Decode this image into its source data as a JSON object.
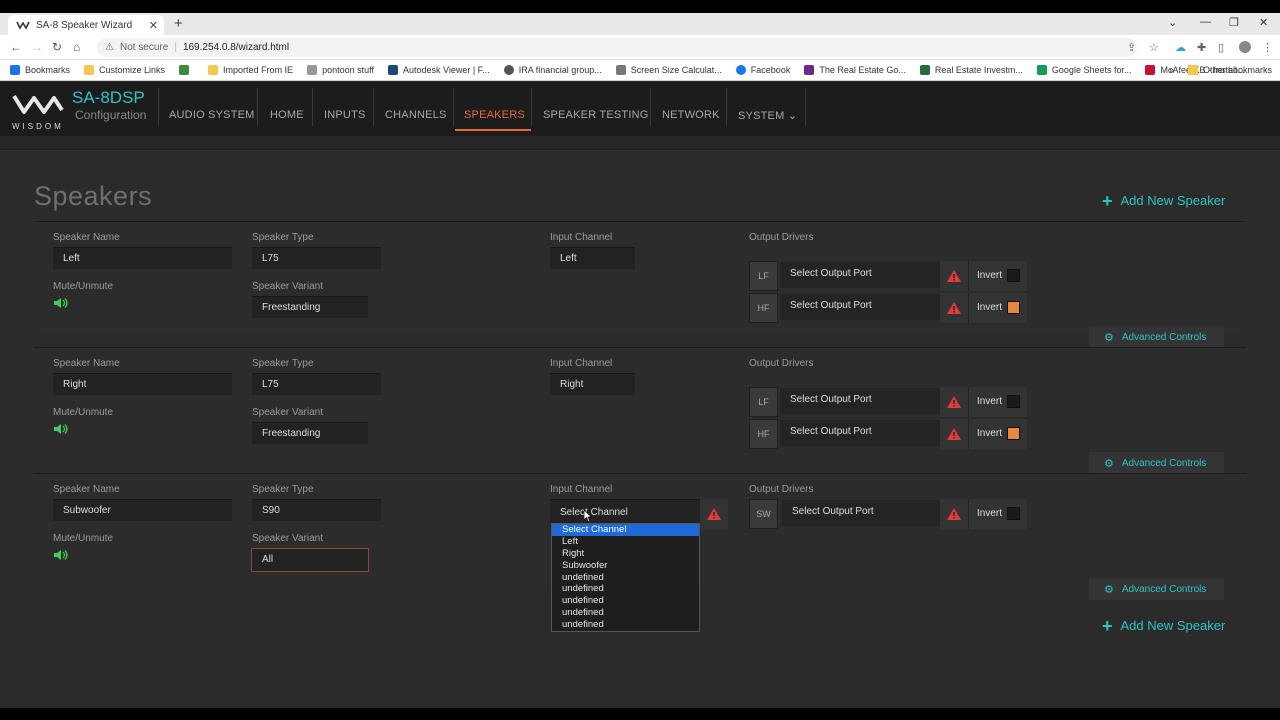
{
  "browser": {
    "tab_title": "SA-8 Speaker Wizard",
    "url_warning": "Not secure",
    "url": "169.254.0.8/wizard.html",
    "bookmarks": [
      "Bookmarks",
      "Customize Links",
      "",
      "Imported From IE",
      "pontoon stuff",
      "Autodesk Viewer | F...",
      "IRA financial group...",
      "Screen Size Calculat...",
      "Facebook",
      "The Real Estate Go...",
      "Real Estate Investm...",
      "Google Sheets for...",
      "McAfee KB - Install..."
    ],
    "other_bookmarks": "Other bookmarks"
  },
  "app": {
    "logo_word": "WISDOM",
    "brand": "SA-8DSP",
    "brand_sub": "Configuration",
    "nav": [
      "AUDIO SYSTEM",
      "HOME",
      "INPUTS",
      "CHANNELS",
      "SPEAKERS",
      "SPEAKER TESTING",
      "NETWORK",
      "SYSTEM"
    ],
    "active_nav": "SPEAKERS",
    "accent_color": "#2ec4c4",
    "active_color": "#e8683a"
  },
  "page": {
    "title": "Speakers",
    "add_speaker": "Add New Speaker"
  },
  "labels": {
    "speaker_name": "Speaker Name",
    "speaker_type": "Speaker Type",
    "input_channel": "Input Channel",
    "output_drivers": "Output Drivers",
    "mute": "Mute/Unmute",
    "variant": "Speaker Variant",
    "invert": "Invert",
    "advanced": "Advanced Controls",
    "select_port": "Select Output Port"
  },
  "speakers": [
    {
      "name": "Left",
      "type": "L75",
      "channel": "Left",
      "variant": "Freestanding",
      "drivers": [
        {
          "tag": "LF",
          "inverted": false
        },
        {
          "tag": "HF",
          "inverted": true
        }
      ]
    },
    {
      "name": "Right",
      "type": "L75",
      "channel": "Right",
      "variant": "Freestanding",
      "drivers": [
        {
          "tag": "LF",
          "inverted": false
        },
        {
          "tag": "HF",
          "inverted": true
        }
      ]
    },
    {
      "name": "Subwoofer",
      "type": "S90",
      "channel": "Select Channel",
      "variant": "All",
      "drivers": [
        {
          "tag": "SW",
          "inverted": false
        }
      ]
    }
  ],
  "dropdown": {
    "options": [
      "Select Channel",
      "Left",
      "Right",
      "Subwoofer",
      "undefined",
      "undefined",
      "undefined",
      "undefined",
      "undefined"
    ],
    "selected_index": 0
  }
}
